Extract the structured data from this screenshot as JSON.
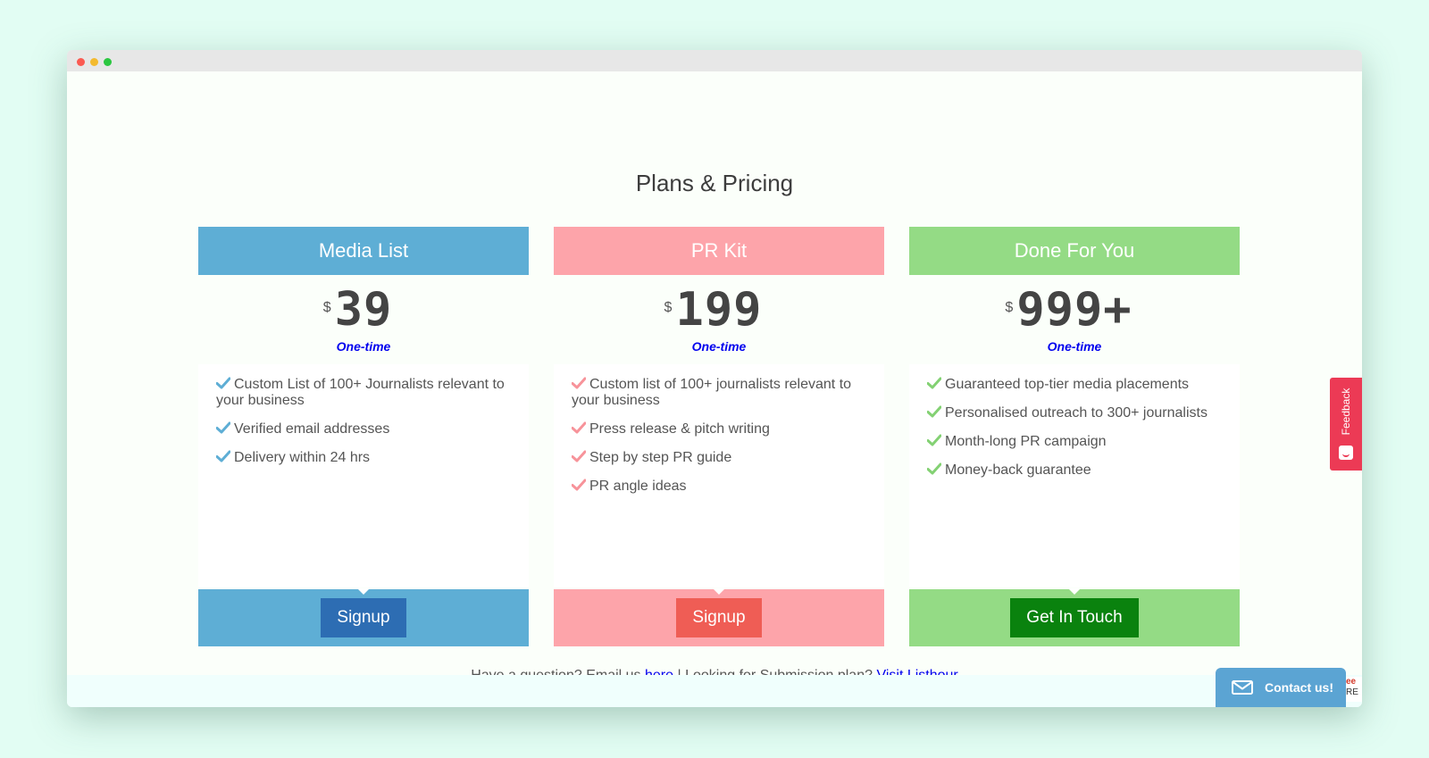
{
  "page": {
    "title": "Plans & Pricing"
  },
  "plans": [
    {
      "name": "Media List",
      "currency": "$",
      "price": "39",
      "period": "One-time",
      "features": [
        "Custom List of 100+ Journalists relevant to your business",
        "Verified email addresses",
        "Delivery within 24 hrs"
      ],
      "cta": "Signup"
    },
    {
      "name": "PR Kit",
      "currency": "$",
      "price": "199",
      "period": "One-time",
      "features": [
        "Custom list of 100+ journalists relevant to your business",
        "Press release & pitch writing",
        "Step by step PR guide",
        "PR angle ideas"
      ],
      "cta": "Signup"
    },
    {
      "name": "Done For You",
      "currency": "$",
      "price": "999+",
      "period": "One-time",
      "features": [
        "Guaranteed top-tier media placements",
        "Personalised outreach to 300+ journalists",
        "Month-long PR campaign",
        "Money-back guarantee"
      ],
      "cta": "Get In Touch"
    }
  ],
  "help": {
    "question_text": "Have a question? Email us",
    "email_link": "here",
    "separator": "| Looking for Submission plan?",
    "listhour_link": "Visit Listhour"
  },
  "widgets": {
    "feedback_label": "Feedback",
    "contact_label": "Contact us!",
    "badge_line1": "ee",
    "badge_line2": "RE"
  },
  "colors": {
    "media_list": "#5eaed5",
    "pr_kit": "#fda4aa",
    "done_for_you": "#94db85",
    "signup_blue": "#2d6db3",
    "signup_red": "#ef5d55",
    "get_in_touch_green": "#0a820e",
    "feedback_tab": "#ec3a55",
    "contact_widget": "#5ba4d3",
    "link": "#0000ee"
  },
  "icons": {
    "feature_bullet": "check-icon",
    "contact": "envelope-icon",
    "feedback": "smiley-icon"
  }
}
